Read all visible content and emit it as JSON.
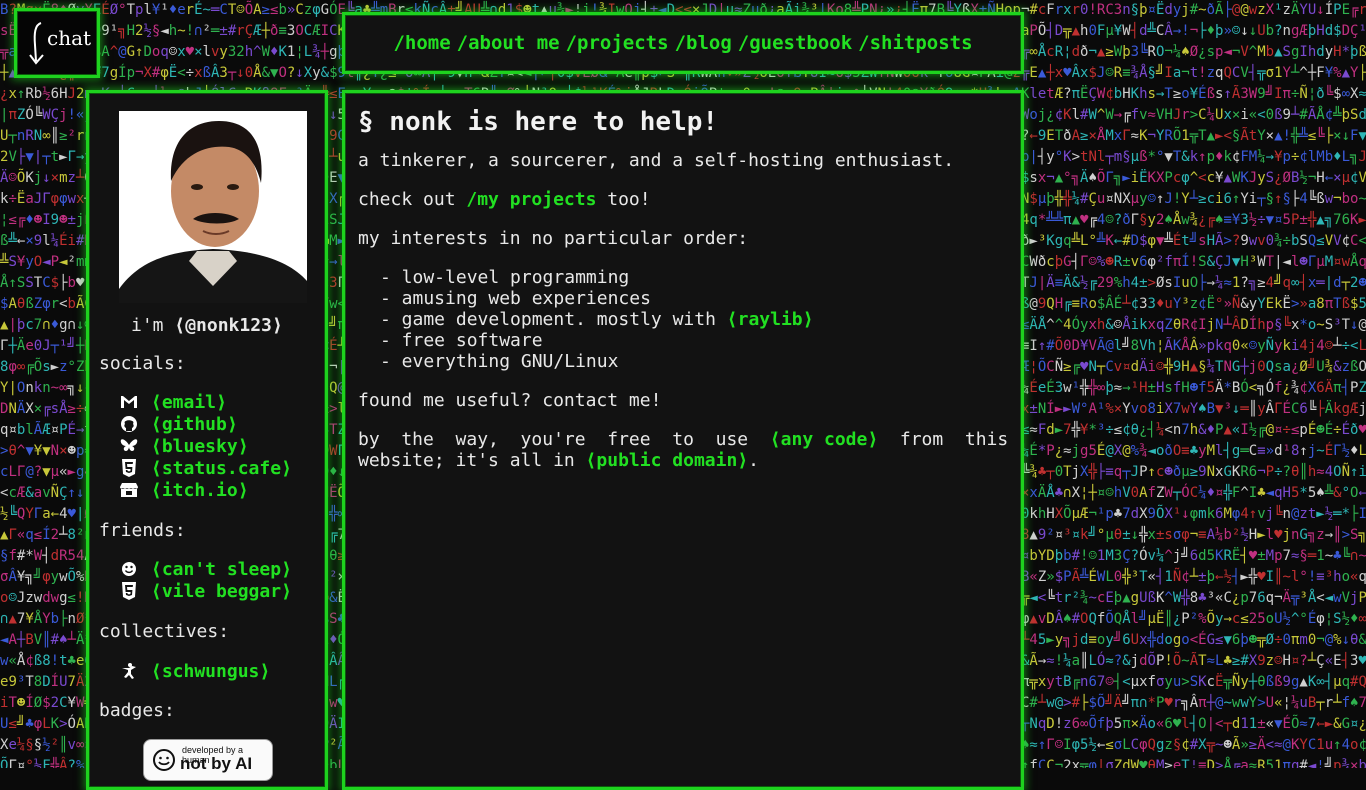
{
  "chat_logo_text": "chat",
  "nav": {
    "home": "/home",
    "about": "/about me",
    "projects": "/projects",
    "blog": "/blog",
    "guestbook": "/guestbook",
    "shitposts": "/shitposts"
  },
  "sidebar": {
    "im_prefix": "i'm ",
    "handle": "⟨@nonk123⟩",
    "socials_label": "socials:",
    "socials": [
      {
        "icon": "gmail-icon",
        "label": "⟨email⟩"
      },
      {
        "icon": "github-icon",
        "label": "⟨github⟩"
      },
      {
        "icon": "bluesky-icon",
        "label": "⟨bluesky⟩"
      },
      {
        "icon": "html5-icon",
        "label": "⟨status.cafe⟩"
      },
      {
        "icon": "itchio-icon",
        "label": "⟨itch.io⟩"
      }
    ],
    "friends_label": "friends:",
    "friends": [
      {
        "icon": "smiley-icon",
        "label": "⟨can't sleep⟩"
      },
      {
        "icon": "html5-icon",
        "label": "⟨vile beggar⟩"
      }
    ],
    "collectives_label": "collectives:",
    "collectives": [
      {
        "icon": "figure-icon",
        "label": "⟨schwungus⟩"
      }
    ],
    "badges_label": "badges:",
    "badge": {
      "small": "developed by a human",
      "big": "not by AI"
    }
  },
  "main": {
    "title": "§ nonk is here to help!",
    "intro": "a tinkerer, a sourcerer, and a self-hosting enthusiast.",
    "checkout_prefix": "check out ",
    "checkout_link": "/my projects",
    "checkout_suffix": " too!",
    "interests_label": "my interests in no particular order:",
    "interests": [
      "- low-level programming",
      "- amusing web experiences",
      "- game development. mostly with ",
      "- free software",
      "- everything GNU/Linux"
    ],
    "raylib_link": "⟨raylib⟩",
    "contact": "found me useful? contact me!",
    "free_prefix": "by  the  way,  you're  free  to  use  ",
    "any_code_link": "⟨any code⟩",
    "free_middle": "  from  this",
    "free_line2_prefix": "website; it's all in ",
    "public_domain_link": "⟨public domain⟩",
    "free_suffix": "."
  },
  "colors": {
    "accent": "#1ed21e",
    "panel": "#121212",
    "text": "#e8e8e8"
  }
}
